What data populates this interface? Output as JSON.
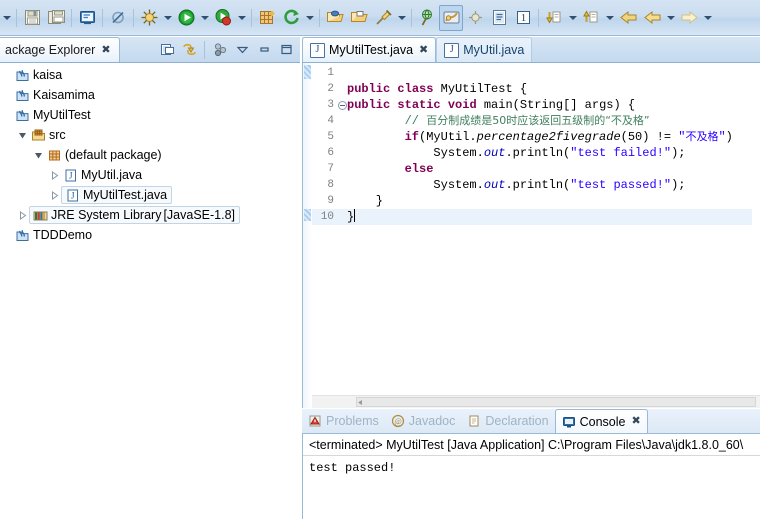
{
  "window": {
    "app": "Eclipse IDE"
  },
  "toolbar": {
    "items": [
      {
        "name": "save-button",
        "icon": "save-icon",
        "tooltip": "Save"
      },
      {
        "name": "save-all-button",
        "icon": "save-all-icon",
        "tooltip": "Save All"
      },
      {
        "name": "new-java-class-button",
        "icon": "new-class-icon",
        "tooltip": "New Java Class"
      },
      {
        "name": "skip-breakpoints-button",
        "icon": "skip-breakpoints-icon",
        "tooltip": "Skip All Breakpoints"
      },
      {
        "name": "debug-button",
        "icon": "debug-bug-icon",
        "tooltip": "Debug"
      },
      {
        "name": "run-button",
        "icon": "run-play-icon",
        "tooltip": "Run"
      },
      {
        "name": "coverage-button",
        "icon": "coverage-icon",
        "tooltip": "Coverage"
      },
      {
        "name": "new-button",
        "icon": "new-wizard-icon",
        "tooltip": "New"
      },
      {
        "name": "external-tools-button",
        "icon": "external-tools-icon",
        "tooltip": "External Tools"
      },
      {
        "name": "open-type-button",
        "icon": "open-folder-icon",
        "tooltip": "Open Type"
      },
      {
        "name": "open-task-button",
        "icon": "open-task-icon",
        "tooltip": "Open Task"
      },
      {
        "name": "pin-button",
        "icon": "pin-icon",
        "tooltip": "Pin"
      },
      {
        "name": "search-button",
        "icon": "search-globe-icon",
        "tooltip": "Search"
      },
      {
        "name": "java-perspective-button",
        "icon": "java-perspective-icon",
        "tooltip": "Java Perspective"
      },
      {
        "name": "debug-perspective-button",
        "icon": "debug-perspective-icon",
        "tooltip": "Debug Perspective"
      },
      {
        "name": "open-task-list-button",
        "icon": "task-list-icon",
        "tooltip": "Task List"
      },
      {
        "name": "toggle-markers-button",
        "icon": "marker-icon",
        "tooltip": "Toggle Mark Occurrences"
      },
      {
        "name": "next-annotation-button",
        "icon": "next-annotation-icon",
        "tooltip": "Next Annotation"
      },
      {
        "name": "previous-annotation-button",
        "icon": "previous-annotation-icon",
        "tooltip": "Previous Annotation"
      },
      {
        "name": "back-button",
        "icon": "back-arrow-icon",
        "tooltip": "Back"
      },
      {
        "name": "forward-yellow-button",
        "icon": "back-arrow-yellow-icon",
        "tooltip": "Back History"
      },
      {
        "name": "forward-button",
        "icon": "forward-arrow-icon",
        "tooltip": "Forward"
      }
    ]
  },
  "package_explorer": {
    "title": "ackage Explorer",
    "close_glyph": "✖",
    "tools": [
      {
        "name": "link-with-editor-button",
        "icon": "link-editor-icon"
      },
      {
        "name": "collapse-all-button",
        "icon": "collapse-all-icon"
      },
      {
        "name": "focus-on-active-task-button",
        "icon": "focus-task-icon"
      },
      {
        "name": "view-menu-button",
        "icon": "chevron-down-icon"
      },
      {
        "name": "minimize-button",
        "icon": "minimize-icon"
      },
      {
        "name": "maximize-button",
        "icon": "maximize-icon"
      }
    ],
    "tree": [
      {
        "label": "kaisa",
        "icon": "java-project-icon",
        "indent": 0,
        "twist": "none",
        "selected": false
      },
      {
        "label": "Kaisamima",
        "icon": "java-project-icon",
        "indent": 0,
        "twist": "none",
        "selected": false
      },
      {
        "label": "MyUtilTest",
        "icon": "java-project-icon",
        "indent": 0,
        "twist": "none",
        "selected": false
      },
      {
        "label": "src",
        "icon": "source-folder-icon",
        "indent": 1,
        "twist": "expanded",
        "selected": false
      },
      {
        "label": "(default package)",
        "icon": "package-icon",
        "indent": 2,
        "twist": "expanded",
        "selected": false
      },
      {
        "label": "MyUtil.java",
        "icon": "java-file-icon",
        "indent": 3,
        "twist": "collapsed",
        "selected": false
      },
      {
        "label": "MyUtilTest.java",
        "icon": "java-file-icon",
        "indent": 3,
        "twist": "collapsed",
        "selected": true
      },
      {
        "label": "JRE System Library",
        "suffix": " [JavaSE-1.8]",
        "icon": "jre-library-icon",
        "indent": 1,
        "twist": "collapsed",
        "selected": true
      },
      {
        "label": "TDDDemo",
        "icon": "java-project-icon",
        "indent": 0,
        "twist": "none",
        "selected": false
      }
    ]
  },
  "editor": {
    "tabs": [
      {
        "label": "MyUtilTest.java",
        "icon": "java-file-icon",
        "active": true,
        "close_glyph": "✖"
      },
      {
        "label": "MyUtil.java",
        "icon": "java-file-icon",
        "active": false,
        "close_glyph": ""
      }
    ],
    "lines": [
      {
        "num": "1",
        "fold": false,
        "current": false,
        "tokens": []
      },
      {
        "num": "2",
        "fold": false,
        "current": false,
        "tokens": [
          {
            "t": "public",
            "c": "kw"
          },
          {
            "t": " ",
            "c": ""
          },
          {
            "t": "class",
            "c": "kw"
          },
          {
            "t": " MyUtilTest {",
            "c": ""
          }
        ]
      },
      {
        "num": "3",
        "fold": true,
        "current": false,
        "tokens": [
          {
            "t": "public",
            "c": "kw"
          },
          {
            "t": " ",
            "c": ""
          },
          {
            "t": "static",
            "c": "kw"
          },
          {
            "t": " ",
            "c": ""
          },
          {
            "t": "void",
            "c": "kw"
          },
          {
            "t": " main(String[] args) {",
            "c": ""
          }
        ]
      },
      {
        "num": "4",
        "fold": false,
        "current": false,
        "tokens": [
          {
            "t": "        // ",
            "c": "cmt"
          },
          {
            "t": "百分制成绩是50时应该返回五级制的“不及格”",
            "c": "cmt cn"
          }
        ]
      },
      {
        "num": "5",
        "fold": false,
        "current": false,
        "tokens": [
          {
            "t": "        ",
            "c": ""
          },
          {
            "t": "if",
            "c": "kw"
          },
          {
            "t": "(MyUtil.",
            "c": ""
          },
          {
            "t": "percentage2fivegrade",
            "c": "ital"
          },
          {
            "t": "(50) != ",
            "c": ""
          },
          {
            "t": "\"",
            "c": "str"
          },
          {
            "t": "不及格",
            "c": "str cn"
          },
          {
            "t": "\"",
            "c": "str"
          },
          {
            "t": ")",
            "c": ""
          }
        ]
      },
      {
        "num": "6",
        "fold": false,
        "current": false,
        "tokens": [
          {
            "t": "            System.",
            "c": ""
          },
          {
            "t": "out",
            "c": "fld ital"
          },
          {
            "t": ".println(",
            "c": ""
          },
          {
            "t": "\"test failed!\"",
            "c": "str"
          },
          {
            "t": ");",
            "c": ""
          }
        ]
      },
      {
        "num": "7",
        "fold": false,
        "current": false,
        "tokens": [
          {
            "t": "        ",
            "c": ""
          },
          {
            "t": "else",
            "c": "kw"
          }
        ]
      },
      {
        "num": "8",
        "fold": false,
        "current": false,
        "tokens": [
          {
            "t": "            System.",
            "c": ""
          },
          {
            "t": "out",
            "c": "fld ital"
          },
          {
            "t": ".println(",
            "c": ""
          },
          {
            "t": "\"test passed!\"",
            "c": "str"
          },
          {
            "t": ");",
            "c": ""
          }
        ]
      },
      {
        "num": "9",
        "fold": false,
        "current": false,
        "tokens": [
          {
            "t": "    }",
            "c": ""
          }
        ]
      },
      {
        "num": "10",
        "fold": false,
        "current": true,
        "tokens": [
          {
            "t": "}",
            "c": ""
          }
        ]
      }
    ]
  },
  "bottom_panel": {
    "tabs": [
      {
        "label": "Problems",
        "icon": "problems-icon",
        "active": false,
        "close_glyph": ""
      },
      {
        "label": "Javadoc",
        "icon": "javadoc-icon",
        "active": false,
        "close_glyph": ""
      },
      {
        "label": "Declaration",
        "icon": "declaration-icon",
        "active": false,
        "close_glyph": ""
      },
      {
        "label": "Console",
        "icon": "console-icon",
        "active": true,
        "close_glyph": "✖"
      }
    ],
    "console": {
      "header": "<terminated> MyUtilTest [Java Application] C:\\Program Files\\Java\\jdk1.8.0_60\\",
      "output": "test passed!"
    }
  },
  "colors": {
    "keyword": "#7f0055",
    "string": "#2a00ff",
    "comment": "#3f7f5f",
    "field": "#0000c0",
    "toolbar_bg": "#cbddf0",
    "selection": "#eaf3fb"
  }
}
